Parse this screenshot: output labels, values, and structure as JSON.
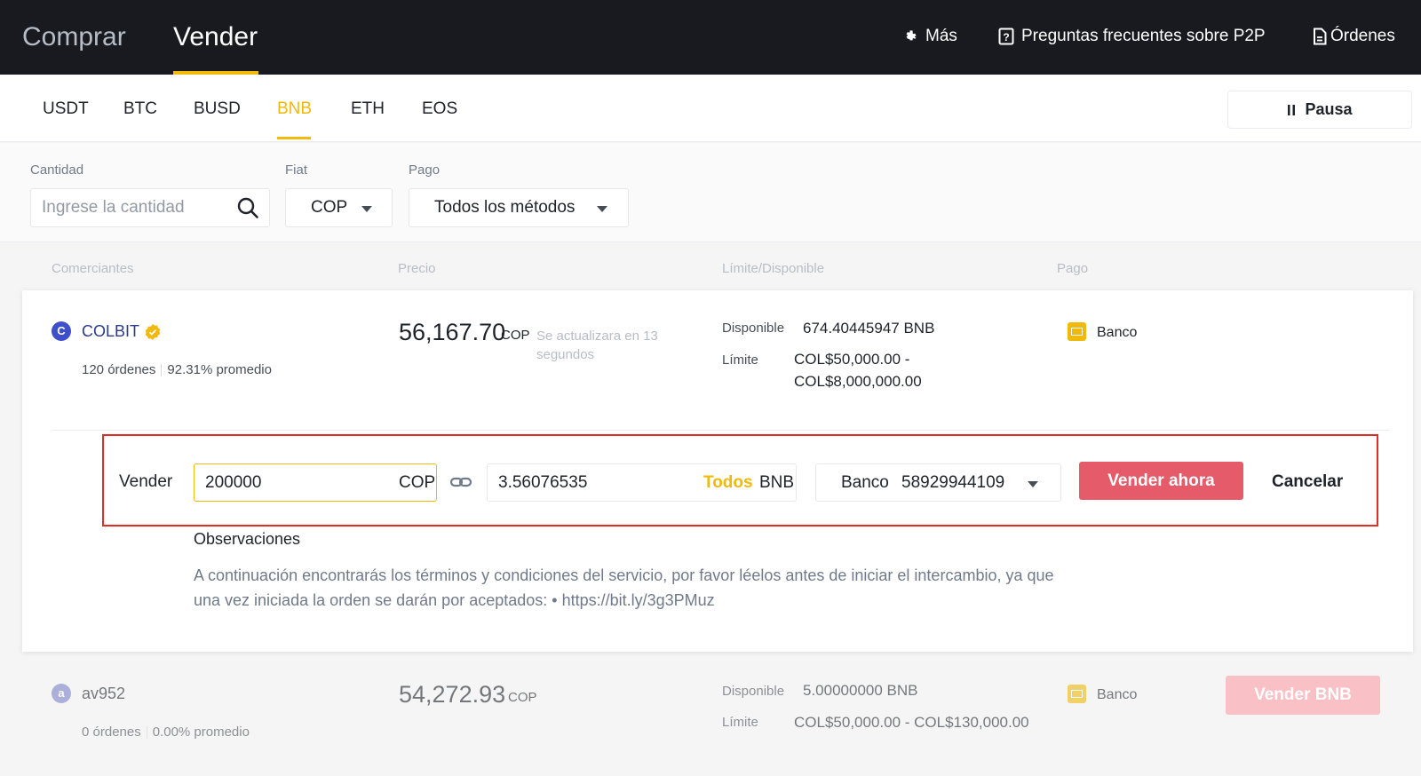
{
  "top_nav": {
    "buy_tab": "Comprar",
    "sell_tab": "Vender",
    "more": "Más",
    "faq": "Preguntas frecuentes sobre P2P",
    "orders": "Órdenes"
  },
  "coin_tabs": [
    "USDT",
    "BTC",
    "BUSD",
    "BNB",
    "ETH",
    "EOS"
  ],
  "active_coin": "BNB",
  "pause_button": "Pausa",
  "filters": {
    "amount_label": "Cantidad",
    "amount_placeholder": "Ingrese la cantidad",
    "fiat_label": "Fiat",
    "fiat_value": "COP",
    "payment_label": "Pago",
    "payment_value": "Todos los métodos"
  },
  "table_headers": {
    "merchants": "Comerciantes",
    "price": "Precio",
    "limit": "Límite/Disponible",
    "payment": "Pago"
  },
  "ads": [
    {
      "avatar_letter": "C",
      "merchant": "COLBIT",
      "orders": "120 órdenes",
      "completion": "92.31% promedio",
      "price": "56,167.70",
      "currency": "COP",
      "price_note": "Se actualizara en 13 segundos",
      "available_label": "Disponible",
      "available": "674.40445947 BNB",
      "limit_label": "Límite",
      "limit_line1": "COL$50,000.00 -",
      "limit_line2": "COL$8,000,000.00",
      "payment": "Banco"
    },
    {
      "avatar_letter": "a",
      "merchant": "av952",
      "orders": "0 órdenes",
      "completion": "0.00% promedio",
      "price": "54,272.93",
      "currency": "COP",
      "available_label": "Disponible",
      "available": "5.00000000 BNB",
      "limit_label": "Límite",
      "limit": "COL$50,000.00 - COL$130,000.00",
      "payment": "Banco",
      "action": "Vender BNB"
    }
  ],
  "sell_form": {
    "label": "Vender",
    "fiat_amount": "200000",
    "fiat_currency": "COP",
    "crypto_amount": "3.56076535",
    "all_label": "Todos",
    "crypto_currency": "BNB",
    "payment_method": "Banco",
    "account": "58929944109",
    "submit": "Vender ahora",
    "cancel": "Cancelar"
  },
  "observations": {
    "title": "Observaciones",
    "text": "A continuación encontrarás los términos y condiciones del servicio, por favor léelos antes de iniciar el intercambio, ya que una vez iniciada la orden se darán por aceptados: • https://bit.ly/3g3PMuz"
  },
  "colors": {
    "brand_yellow": "#f0b90b",
    "sell_red": "#e55b6a",
    "highlight_red": "#e02d27",
    "top_bar": "#181a20"
  }
}
